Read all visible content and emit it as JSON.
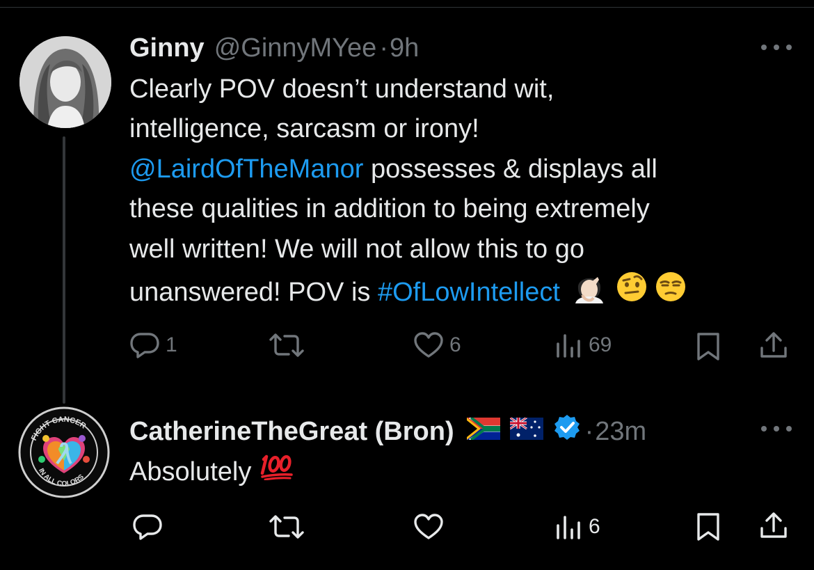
{
  "colors": {
    "link": "#1d9bf0",
    "muted": "#71767b",
    "text": "#e7e9ea",
    "verified": "#1d9bf0"
  },
  "tweet1": {
    "name": "Ginny",
    "handle": "@GinnyMYee",
    "sep": "·",
    "time": "9h",
    "lines": [
      "Clearly POV doesn’t understand wit,",
      "intelligence, sarcasm or irony!"
    ],
    "mention": "@LairdOfTheManor",
    "line3_rest": " possesses & displays all",
    "line4": "these qualities in addition to being extremely",
    "line5": "well written! We will not allow this to go",
    "line6_start": "unanswered! POV is ",
    "hashtag": "#OfLowIntellect",
    "emojis": [
      "facepalm-emoji",
      "raised-eyebrow-emoji",
      "unamused-emoji"
    ],
    "actions": {
      "replies": "1",
      "reposts": "",
      "likes": "6",
      "views": "69"
    }
  },
  "tweet2": {
    "name": "CatherineTheGreat (Bron)",
    "flags": [
      "south-africa-flag",
      "australia-flag"
    ],
    "verified": true,
    "sep": "·",
    "time": "23m",
    "text": "Absolutely",
    "emoji": "hundred-points-emoji",
    "avatar_text_top": "FIGHT CANCER",
    "avatar_text_bottom": "IN ALL COLORS",
    "actions": {
      "replies": "",
      "reposts": "",
      "likes": "",
      "views": "6"
    }
  }
}
